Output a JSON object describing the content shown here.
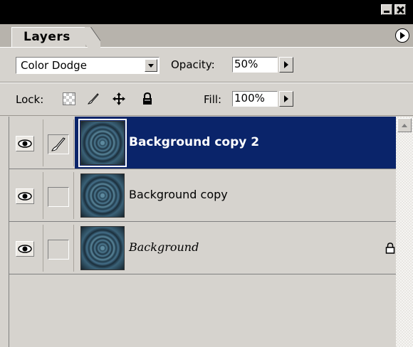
{
  "panel": {
    "tab_label": "Layers"
  },
  "blend": {
    "mode": "Color Dodge",
    "opacity_label": "Opacity:",
    "opacity_value": "50%"
  },
  "lock": {
    "label": "Lock:",
    "fill_label": "Fill:",
    "fill_value": "100%"
  },
  "layers": [
    {
      "name": "Background copy 2",
      "selected": true,
      "visible": true,
      "linked_brush": true,
      "locked": false
    },
    {
      "name": "Background copy",
      "selected": false,
      "visible": true,
      "linked_brush": false,
      "locked": false
    },
    {
      "name": "Background",
      "selected": false,
      "visible": true,
      "linked_brush": false,
      "locked": true,
      "italic": true
    }
  ],
  "colors": {
    "selection": "#0a246a",
    "panel_bg": "#d6d3ce",
    "title_bar": "#000000"
  },
  "icons": [
    "minimize-icon",
    "close-icon",
    "panel-menu-icon",
    "eye-icon",
    "brush-icon",
    "move-icon",
    "lock-icon",
    "transparency-lock-icon",
    "scroll-up-icon"
  ]
}
